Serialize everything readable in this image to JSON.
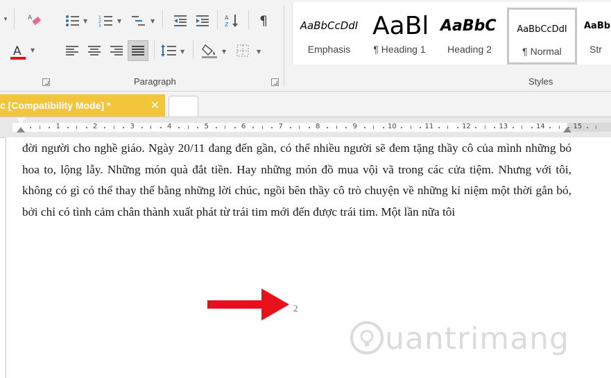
{
  "ribbon": {
    "paragraph_label": "Paragraph",
    "styles_label": "Styles",
    "colors": {
      "font_color_bar": "#e8101b"
    },
    "icons": [
      "eraser-icon",
      "bullets-icon",
      "numbering-icon",
      "multilevel-list-icon",
      "decrease-indent-icon",
      "increase-indent-icon",
      "sort-icon",
      "pilcrow-icon",
      "font-color-icon",
      "align-left-icon",
      "align-center-icon",
      "align-right-icon",
      "justify-icon",
      "line-spacing-icon",
      "shading-icon",
      "borders-icon"
    ]
  },
  "styles": [
    {
      "sample": "AaBbCcDdI",
      "name": "Emphasis"
    },
    {
      "sample": "AaBl",
      "name": "¶ Heading 1"
    },
    {
      "sample": "AaBbC",
      "name": "Heading 2"
    },
    {
      "sample": "AaBbCcDdI",
      "name": "¶ Normal"
    },
    {
      "sample": "AaBb",
      "name": "Str"
    }
  ],
  "document_tab": {
    "title": "c [Compatibility Mode] *",
    "close_glyph": "✕",
    "color": "#f3c53a"
  },
  "ruler": {
    "numbers": [
      "1",
      "2",
      "3",
      "4",
      "5",
      "6",
      "7",
      "8",
      "9",
      "10",
      "11",
      "12",
      "13",
      "14",
      "15"
    ]
  },
  "document": {
    "body": "đời người cho nghề giáo. Ngày 20/11 đang đến gần, có thể nhiều người sẽ đem tặng thầy cô của mình những bó hoa to, lộng lẫy. Những món quà đắt tiền. Hay những món đồ mua vội vã trong các cửa tiệm. Nhưng với tôi, không có gì có thể thay thế bằng những lời chúc, ngồi bên thầy cô trò chuyện về những kỉ niệm một thời gắn bó, bởi chỉ có tình cảm chân thành xuất phát từ trái tim mới đến được trái tim. Một lần nữa tôi",
    "page_number": "2",
    "arrow_color": "#e8101b"
  },
  "watermark": {
    "text": "uantrimang",
    "icon": "quantrimang-logo-icon"
  }
}
